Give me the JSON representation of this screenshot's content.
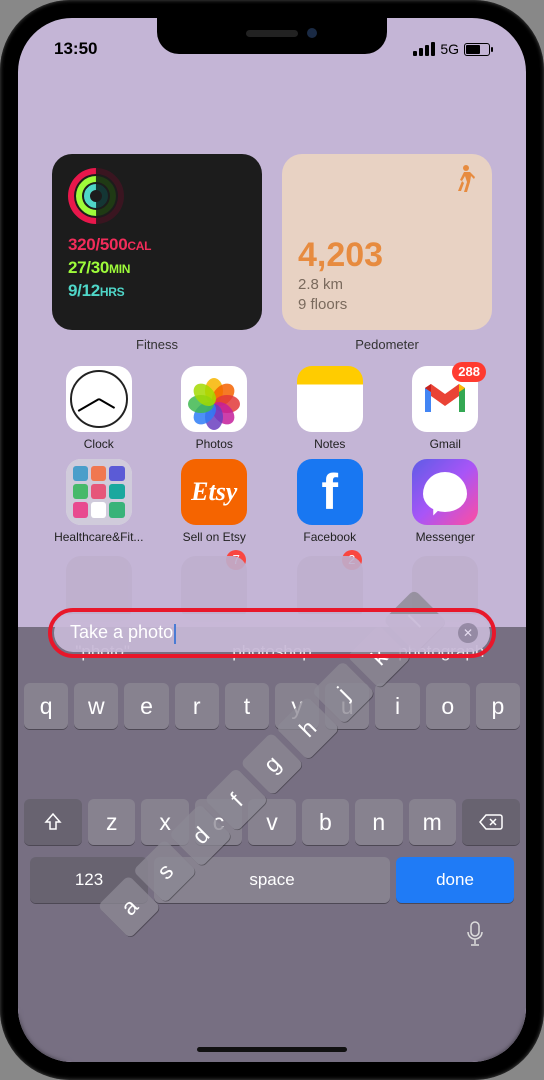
{
  "status": {
    "time": "13:50",
    "net": "5G"
  },
  "fitness": {
    "label": "Fitness",
    "cal": "320/500",
    "cal_unit": "CAL",
    "min": "27/30",
    "min_unit": "MIN",
    "hrs": "9/12",
    "hrs_unit": "HRS"
  },
  "pedometer": {
    "label": "Pedometer",
    "steps": "4,203",
    "dist": "2.8 km",
    "floors": "9 floors"
  },
  "apps": {
    "clock": "Clock",
    "photos": "Photos",
    "notes": "Notes",
    "gmail": "Gmail",
    "gmail_badge": "288",
    "healthcare": "Healthcare&Fit...",
    "etsy": "Sell on Etsy",
    "facebook": "Facebook",
    "messenger": "Messenger"
  },
  "hint_badges": {
    "b2": "7",
    "b3": "2"
  },
  "search": {
    "text": "Take a photo"
  },
  "suggestions": {
    "s1": "\"photo\"",
    "s2": "photoshop",
    "s3": "photograph"
  },
  "keyboard": {
    "r1": [
      "q",
      "w",
      "e",
      "r",
      "t",
      "y",
      "u",
      "i",
      "o",
      "p"
    ],
    "r2": [
      "a",
      "s",
      "d",
      "f",
      "g",
      "h",
      "j",
      "k",
      "l"
    ],
    "r3": [
      "z",
      "x",
      "c",
      "v",
      "b",
      "n",
      "m"
    ],
    "num": "123",
    "space": "space",
    "done": "done"
  }
}
